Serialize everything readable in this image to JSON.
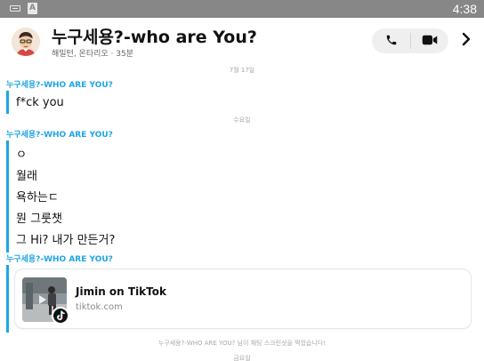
{
  "status_bar": {
    "time": "4:38",
    "icons": [
      "keyboard-icon",
      "a-letter-icon"
    ]
  },
  "header": {
    "title": "누구세용?-who are You?",
    "subtitle": "해밀턴, 온타리오 · 35분",
    "icons": [
      "avatar",
      "phone-icon",
      "video-camera-icon",
      "chevron-right-icon"
    ]
  },
  "chat": {
    "date1": "7월 17일",
    "sender1": "누구세용?-WHO ARE YOU?",
    "msg1": "f*ck you",
    "date2": "수요일",
    "sender2": "누구세용?-WHO ARE YOU?",
    "messages2": [
      "ㅇ",
      "월래",
      "욕하는ㄷ",
      "뭔 그룻챗",
      "그 Hi? 내가 만든거?"
    ],
    "sender3": "누구세용?-WHO ARE YOU?",
    "link_card": {
      "title": "Jimin on TikTok",
      "domain": "tiktok.com",
      "badge_icon": "tiktok-icon"
    },
    "screenshot_notice": "누구세용?-WHO ARE YOU? 님이 채팅 스크린샷을 찍었습니다!",
    "date3": "금요일"
  },
  "colors": {
    "accent": "#1ea5e6",
    "status_bar": "#878787",
    "muted_text": "#a8a8a8"
  }
}
